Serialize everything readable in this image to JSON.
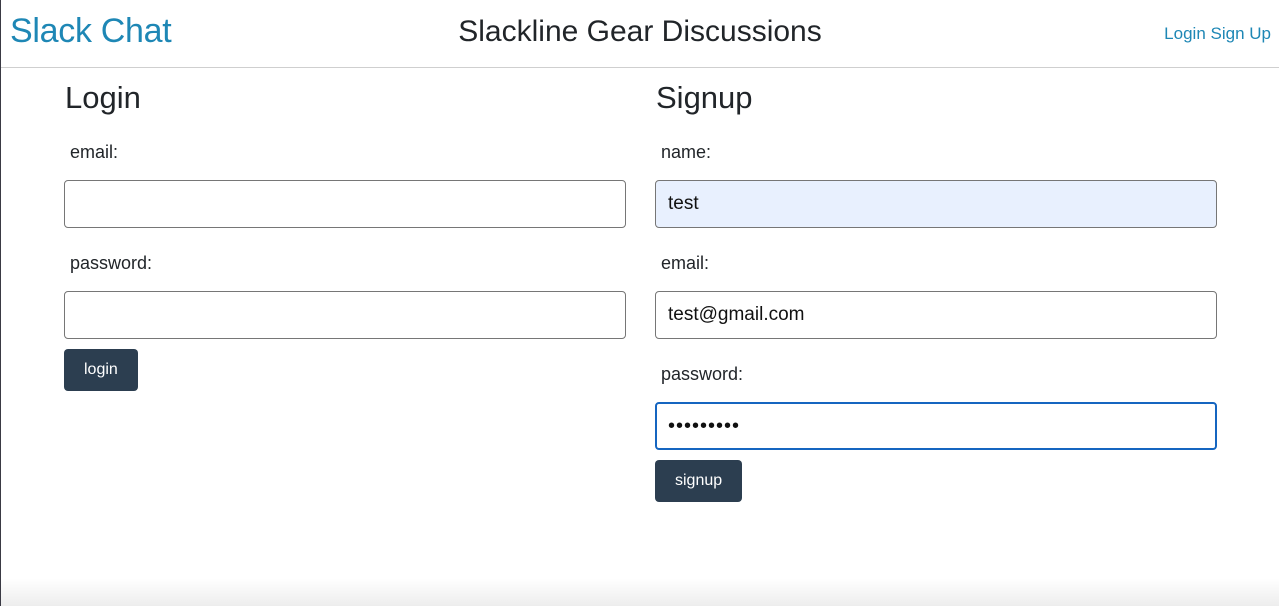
{
  "navbar": {
    "brand": "Slack Chat",
    "title": "Slackline Gear Discussions",
    "links": [
      {
        "label": "Login"
      },
      {
        "label": "Sign Up"
      }
    ],
    "link_color": "#1e87b5"
  },
  "login": {
    "heading": "Login",
    "email_label": "email:",
    "email_value": "",
    "password_label": "password:",
    "password_value": "",
    "button_label": "login"
  },
  "signup": {
    "heading": "Signup",
    "name_label": "name:",
    "name_value": "test",
    "email_label": "email:",
    "email_value": "test@gmail.com",
    "password_label": "password:",
    "password_value": "•••••••••",
    "button_label": "signup"
  },
  "colors": {
    "button_bg": "#2c3e50",
    "autofill_bg": "#e8f0fe",
    "focus_border": "#1565c0"
  }
}
